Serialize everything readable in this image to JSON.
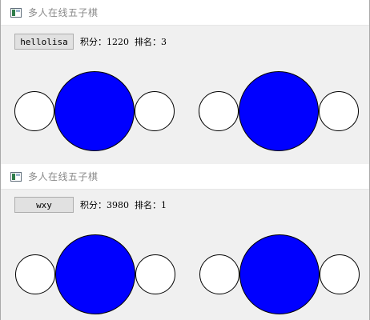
{
  "windows": [
    {
      "title": "多人在线五子棋",
      "player_name": "hellolisa",
      "stats": "积分：1220  排名：3"
    },
    {
      "title": "多人在线五子棋",
      "player_name": "wxy",
      "stats": "积分：3980  排名：1"
    }
  ],
  "colors": {
    "big_piece": "#0000ff",
    "small_piece": "#ffffff",
    "window_bg": "#f0f0f0"
  }
}
